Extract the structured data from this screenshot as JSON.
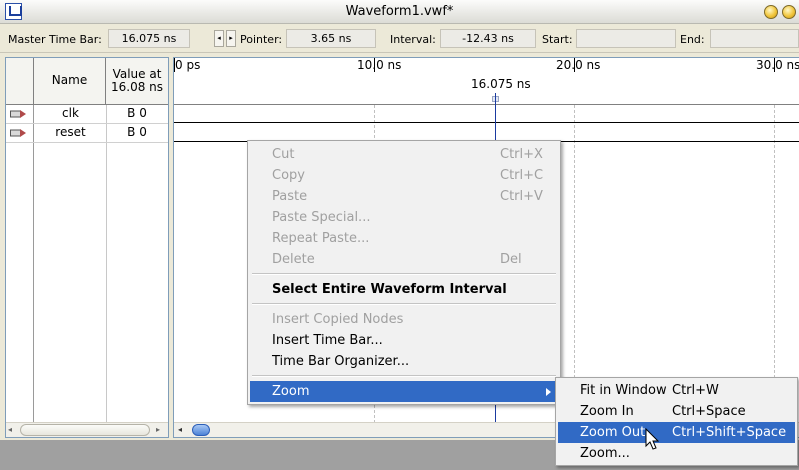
{
  "window": {
    "title": "Waveform1.vwf*"
  },
  "topbar": {
    "master_label": "Master Time Bar:",
    "master_value": "16.075 ns",
    "pointer_label": "Pointer:",
    "pointer_value": "3.65 ns",
    "interval_label": "Interval:",
    "interval_value": "-12.43 ns",
    "start_label": "Start:",
    "start_value": "",
    "end_label": "End:",
    "end_value": ""
  },
  "nodes": {
    "col_name": "Name",
    "col_value_1": "Value at",
    "col_value_2": "16.08 ns",
    "rows": [
      {
        "name": "clk",
        "value": "B 0"
      },
      {
        "name": "reset",
        "value": "B 0"
      }
    ]
  },
  "ruler": {
    "ticks": [
      "0 ps",
      "10.0 ns",
      "20.0 ns",
      "30.0 ns"
    ],
    "cursor_label": "16.075 ns"
  },
  "context_menu": {
    "cut": {
      "label": "Cut",
      "shortcut": "Ctrl+X"
    },
    "copy": {
      "label": "Copy",
      "shortcut": "Ctrl+C"
    },
    "paste": {
      "label": "Paste",
      "shortcut": "Ctrl+V"
    },
    "paste_special": {
      "label": "Paste Special..."
    },
    "repeat_paste": {
      "label": "Repeat Paste..."
    },
    "delete": {
      "label": "Delete",
      "shortcut": "Del"
    },
    "select_entire": {
      "label": "Select Entire Waveform Interval"
    },
    "insert_copied": {
      "label": "Insert Copied Nodes"
    },
    "insert_time_bar": {
      "label": "Insert Time Bar..."
    },
    "time_bar_organizer": {
      "label": "Time Bar Organizer..."
    },
    "zoom": {
      "label": "Zoom"
    }
  },
  "zoom_submenu": {
    "fit": {
      "label": "Fit in Window",
      "shortcut": "Ctrl+W"
    },
    "zoom_in": {
      "label": "Zoom In",
      "shortcut": "Ctrl+Space"
    },
    "zoom_out": {
      "label": "Zoom Out",
      "shortcut": "Ctrl+Shift+Space"
    },
    "zoom_dialog": {
      "label": "Zoom..."
    }
  },
  "colors": {
    "highlight": "#316ac5",
    "cursor": "#1a3aa0"
  }
}
